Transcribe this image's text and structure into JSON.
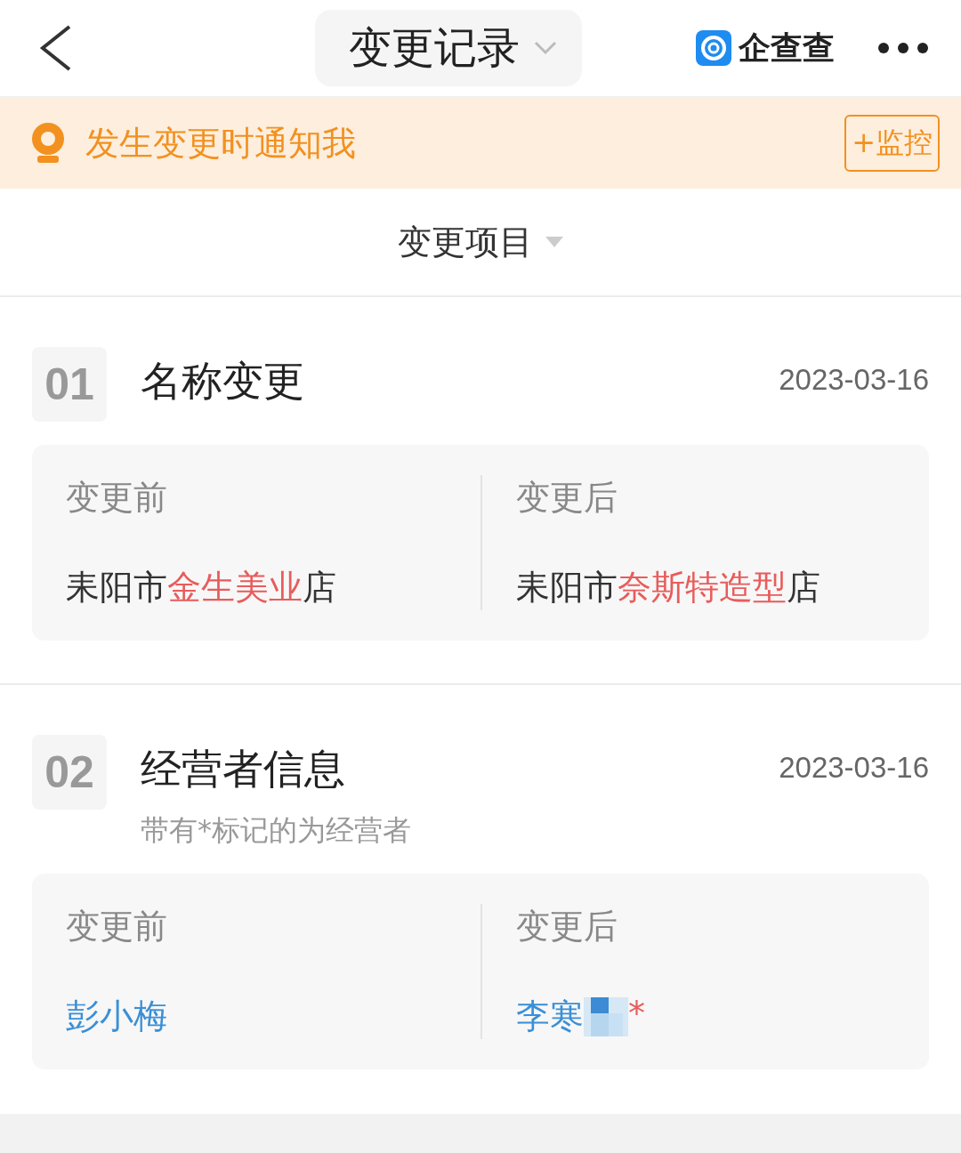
{
  "header": {
    "title": "变更记录",
    "brand": "企查查"
  },
  "notice": {
    "text": "发生变更时通知我",
    "button": "+监控"
  },
  "filter": {
    "label": "变更项目"
  },
  "records": [
    {
      "index": "01",
      "title": "名称变更",
      "date": "2023-03-16",
      "before": {
        "label": "变更前",
        "segments": [
          {
            "kind": "plain",
            "text": "耒阳市"
          },
          {
            "kind": "changed",
            "text": "金生美业"
          },
          {
            "kind": "plain",
            "text": "店"
          }
        ]
      },
      "after": {
        "label": "变更后",
        "segments": [
          {
            "kind": "plain",
            "text": "耒阳市"
          },
          {
            "kind": "changed",
            "text": "奈斯特造型"
          },
          {
            "kind": "plain",
            "text": "店"
          }
        ]
      }
    },
    {
      "index": "02",
      "title": "经营者信息",
      "date": "2023-03-16",
      "note": "带有*标记的为经营者",
      "before": {
        "label": "变更前",
        "segments": [
          {
            "kind": "person",
            "text": "彭小梅"
          }
        ]
      },
      "after": {
        "label": "变更后",
        "segments": [
          {
            "kind": "person",
            "text": "李寒"
          },
          {
            "kind": "redacted"
          },
          {
            "kind": "mark",
            "text": "*"
          }
        ]
      }
    }
  ]
}
